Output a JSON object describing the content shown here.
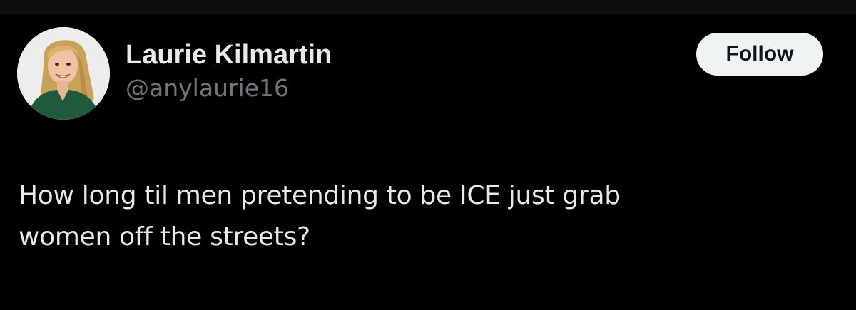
{
  "user": {
    "display_name": "Laurie Kilmartin",
    "handle": "@anylaurie16",
    "avatar_icon": "profile-photo"
  },
  "actions": {
    "follow_label": "Follow"
  },
  "tweet": {
    "text": "How long til men pretending to be ICE just grab\nwomen off the streets?"
  },
  "colors": {
    "background": "#000000",
    "text_primary": "#e7e9ea",
    "text_secondary": "#71767b",
    "button_bg": "#eff3f4",
    "button_text": "#0f1419"
  }
}
